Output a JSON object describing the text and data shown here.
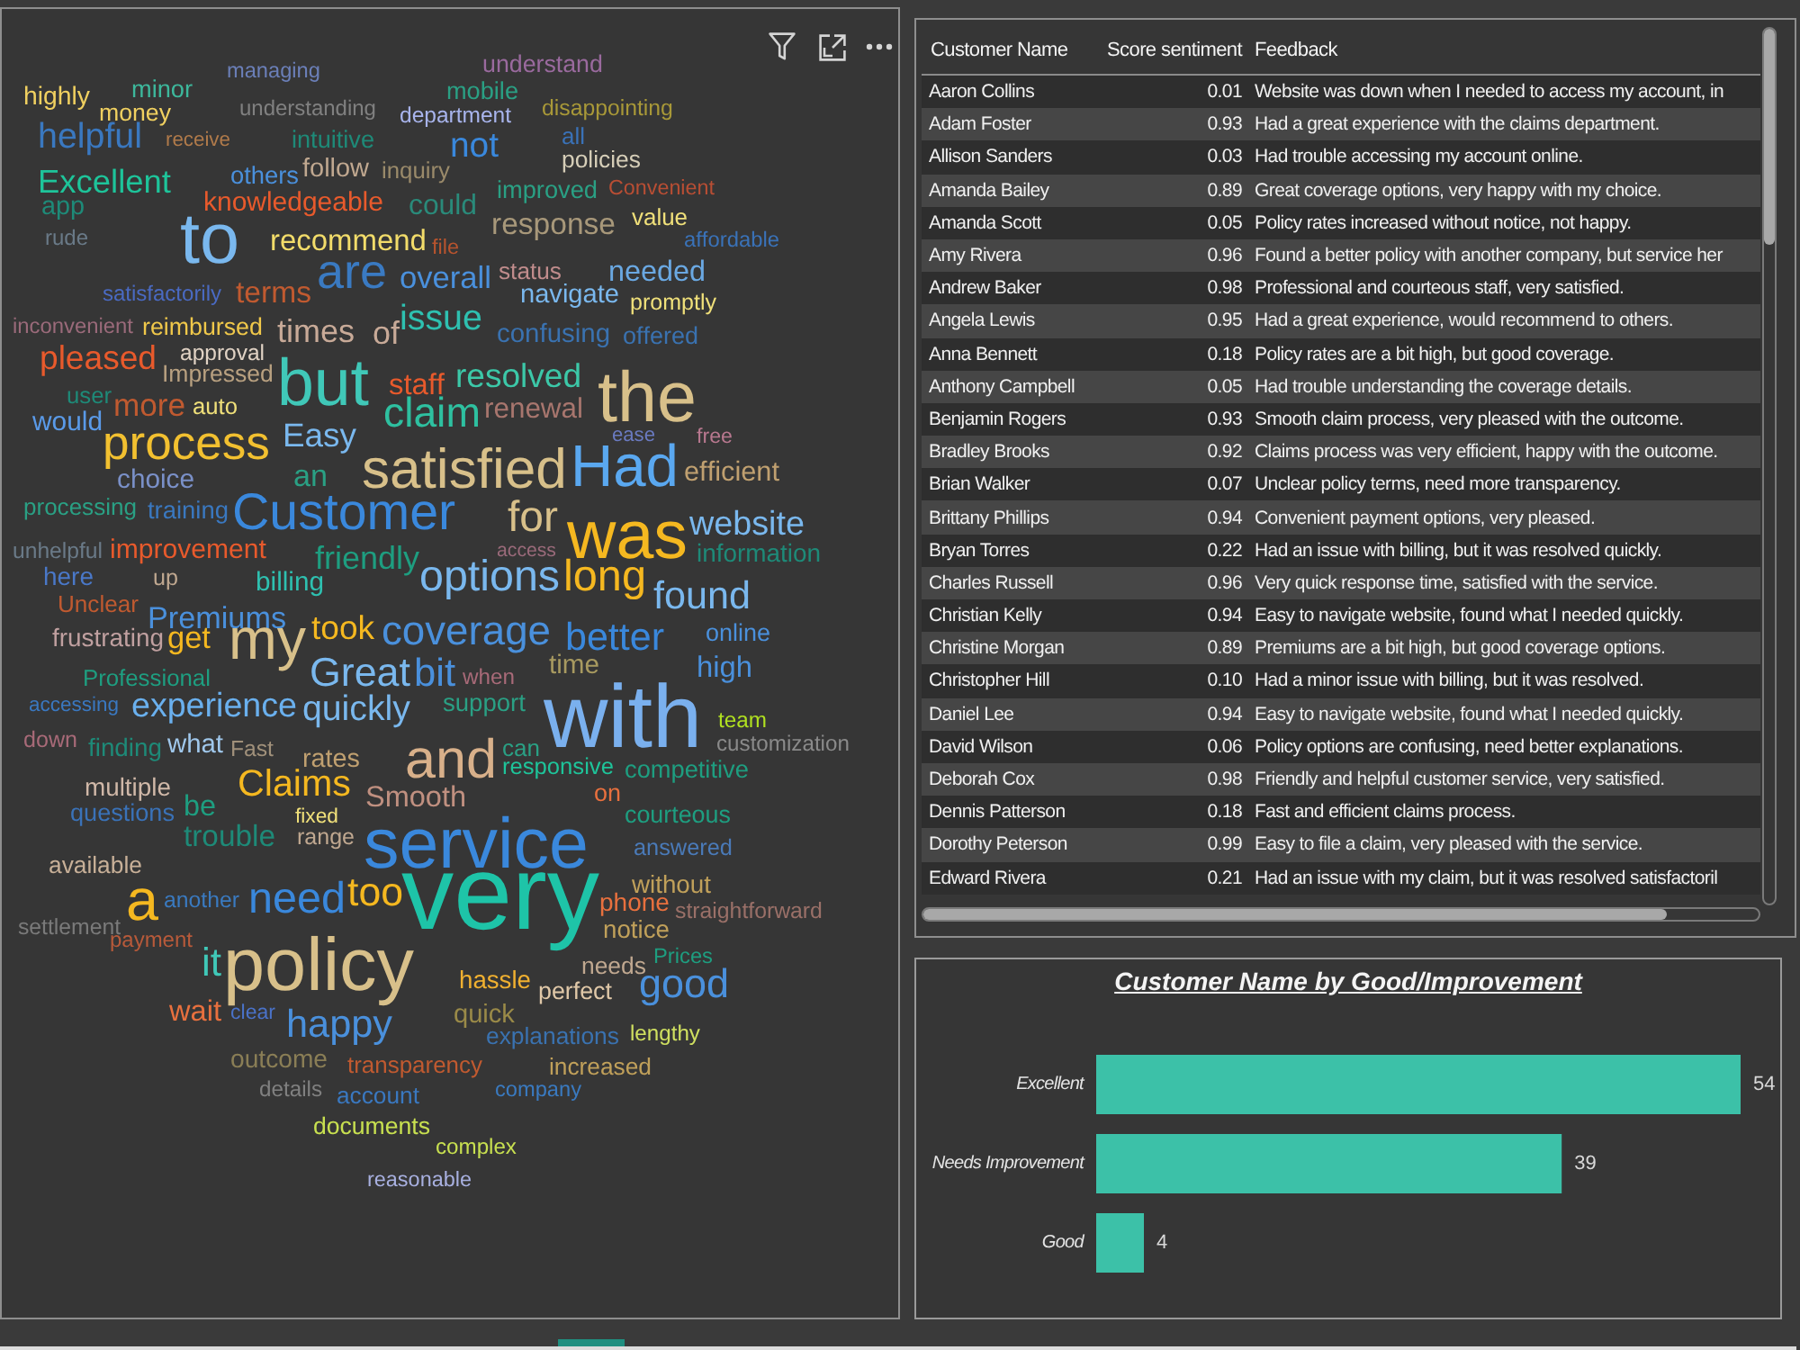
{
  "word_cloud": {
    "words": [
      {
        "text": "managing",
        "color": "#6b7fb8"
      },
      {
        "text": "understand",
        "color": "#9a6a9e"
      },
      {
        "text": "highly",
        "color": "#f0d060"
      },
      {
        "text": "minor",
        "color": "#3db89c"
      },
      {
        "text": "mobile",
        "color": "#2aa084"
      },
      {
        "text": "money",
        "color": "#f0d060"
      },
      {
        "text": "understanding",
        "color": "#808080"
      },
      {
        "text": "department",
        "color": "#a8b4ec"
      },
      {
        "text": "disappointing",
        "color": "#a89838"
      },
      {
        "text": "helpful",
        "color": "#3a78c0"
      },
      {
        "text": "receive",
        "color": "#b07a4a"
      },
      {
        "text": "intuitive",
        "color": "#1e8a78"
      },
      {
        "text": "not",
        "color": "#3a88dc"
      },
      {
        "text": "all",
        "color": "#3a72b8"
      },
      {
        "text": "follow",
        "color": "#c0a890"
      },
      {
        "text": "policies",
        "color": "#d6ceb8"
      },
      {
        "text": "Excellent",
        "color": "#1ec49a"
      },
      {
        "text": "others",
        "color": "#4a90dc"
      },
      {
        "text": "inquiry",
        "color": "#9a8a6a"
      },
      {
        "text": "improved",
        "color": "#2aa084"
      },
      {
        "text": "Convenient",
        "color": "#b84e34"
      },
      {
        "text": "app",
        "color": "#1e8a78"
      },
      {
        "text": "knowledgeable",
        "color": "#e85a2c"
      },
      {
        "text": "could",
        "color": "#2a8a7a"
      },
      {
        "text": "response",
        "color": "#a8987a"
      },
      {
        "text": "value",
        "color": "#f0e07a"
      },
      {
        "text": "rude",
        "color": "#6a7a88"
      },
      {
        "text": "to",
        "color": "#7ab8ee"
      },
      {
        "text": "recommend",
        "color": "#f2dc6a"
      },
      {
        "text": "file",
        "color": "#b8542e"
      },
      {
        "text": "affordable",
        "color": "#3a72b8"
      },
      {
        "text": "are",
        "color": "#3a7ac2"
      },
      {
        "text": "overall",
        "color": "#4a90dc"
      },
      {
        "text": "status",
        "color": "#c08c8c"
      },
      {
        "text": "needed",
        "color": "#6aa8e2"
      },
      {
        "text": "satisfactorily",
        "color": "#4a6ac2"
      },
      {
        "text": "terms",
        "color": "#c05a30"
      },
      {
        "text": "navigate",
        "color": "#7ab8ee"
      },
      {
        "text": "promptly",
        "color": "#f0e07a"
      },
      {
        "text": "inconvenient",
        "color": "#9a6a7a"
      },
      {
        "text": "reimbursed",
        "color": "#f0c84a"
      },
      {
        "text": "times",
        "color": "#c8aa98"
      },
      {
        "text": "of",
        "color": "#c8aa98"
      },
      {
        "text": "issue",
        "color": "#2ec0b0"
      },
      {
        "text": "confusing",
        "color": "#3a72b0"
      },
      {
        "text": "offered",
        "color": "#3a72b0"
      },
      {
        "text": "pleased",
        "color": "#e85a2c"
      },
      {
        "text": "approval",
        "color": "#e0d2c4"
      },
      {
        "text": "Impressed",
        "color": "#b8a080"
      },
      {
        "text": "but",
        "color": "#40c8b8"
      },
      {
        "text": "staff",
        "color": "#e85a2c"
      },
      {
        "text": "resolved",
        "color": "#3cc8a8"
      },
      {
        "text": "user",
        "color": "#1e8a78"
      },
      {
        "text": "more",
        "color": "#c05a30"
      },
      {
        "text": "auto",
        "color": "#f0e07a"
      },
      {
        "text": "would",
        "color": "#5a9ae8"
      },
      {
        "text": "claim",
        "color": "#2ec0a0"
      },
      {
        "text": "renewal",
        "color": "#a8766e"
      },
      {
        "text": "the",
        "color": "#d8c08a"
      },
      {
        "text": "process",
        "color": "#f2c030"
      },
      {
        "text": "Easy",
        "color": "#7ab8ee"
      },
      {
        "text": "ease",
        "color": "#6a7ac0"
      },
      {
        "text": "free",
        "color": "#b8788f"
      },
      {
        "text": "choice",
        "color": "#7a90c8"
      },
      {
        "text": "an",
        "color": "#2aa084"
      },
      {
        "text": "satisfied",
        "color": "#d8c08a"
      },
      {
        "text": "Had",
        "color": "#5aa8f0"
      },
      {
        "text": "efficient",
        "color": "#c0a070"
      },
      {
        "text": "processing",
        "color": "#2aa084"
      },
      {
        "text": "training",
        "color": "#3a78c0"
      },
      {
        "text": "Customer",
        "color": "#3a88dc"
      },
      {
        "text": "for",
        "color": "#d8c08a"
      },
      {
        "text": "was",
        "color": "#f5b820"
      },
      {
        "text": "website",
        "color": "#7ab8ee"
      },
      {
        "text": "unhelpful",
        "color": "#6a7a88"
      },
      {
        "text": "improvement",
        "color": "#e85a2c"
      },
      {
        "text": "friendly",
        "color": "#1e9e80"
      },
      {
        "text": "access",
        "color": "#9a6a7a"
      },
      {
        "text": "information",
        "color": "#1e8a78"
      },
      {
        "text": "here",
        "color": "#4a78c8"
      },
      {
        "text": "up",
        "color": "#c0a890"
      },
      {
        "text": "billing",
        "color": "#2ec0b0"
      },
      {
        "text": "options",
        "color": "#7ab8ee"
      },
      {
        "text": "long",
        "color": "#f5b820"
      },
      {
        "text": "Unclear",
        "color": "#c05a30"
      },
      {
        "text": "found",
        "color": "#7ab8ee"
      },
      {
        "text": "Premiums",
        "color": "#4a90dc"
      },
      {
        "text": "frustrating",
        "color": "#c0a0a0"
      },
      {
        "text": "get",
        "color": "#f5b820"
      },
      {
        "text": "my",
        "color": "#d8c08a"
      },
      {
        "text": "took",
        "color": "#f5b820"
      },
      {
        "text": "coverage",
        "color": "#4a90dc"
      },
      {
        "text": "better",
        "color": "#3a88dc"
      },
      {
        "text": "online",
        "color": "#4a90dc"
      },
      {
        "text": "Professional",
        "color": "#1e9e80"
      },
      {
        "text": "Great",
        "color": "#7ab8ee"
      },
      {
        "text": "bit",
        "color": "#4a90dc"
      },
      {
        "text": "when",
        "color": "#a86a78"
      },
      {
        "text": "time",
        "color": "#a89a60"
      },
      {
        "text": "high",
        "color": "#4a90dc"
      },
      {
        "text": "accessing",
        "color": "#3a78c0"
      },
      {
        "text": "experience",
        "color": "#6ab0ee"
      },
      {
        "text": "quickly",
        "color": "#7ab8ee"
      },
      {
        "text": "support",
        "color": "#2aa084"
      },
      {
        "text": "with",
        "color": "#7ab0ee"
      },
      {
        "text": "team",
        "color": "#b0e020"
      },
      {
        "text": "down",
        "color": "#a86a78"
      },
      {
        "text": "finding",
        "color": "#1e8a78"
      },
      {
        "text": "what",
        "color": "#a0c8ec"
      },
      {
        "text": "Fast",
        "color": "#a0907a"
      },
      {
        "text": "can",
        "color": "#2aa084"
      },
      {
        "text": "customization",
        "color": "#8a8a8a"
      },
      {
        "text": "rates",
        "color": "#c0a070"
      },
      {
        "text": "and",
        "color": "#d8b08a"
      },
      {
        "text": "responsive",
        "color": "#1ec49a"
      },
      {
        "text": "competitive",
        "color": "#1e9e80"
      },
      {
        "text": "multiple",
        "color": "#d0b8a8"
      },
      {
        "text": "Claims",
        "color": "#f5b820"
      },
      {
        "text": "Smooth",
        "color": "#c09080"
      },
      {
        "text": "on",
        "color": "#e8703e"
      },
      {
        "text": "questions",
        "color": "#3a72b8"
      },
      {
        "text": "be",
        "color": "#1e9e80"
      },
      {
        "text": "fixed",
        "color": "#f0e07a"
      },
      {
        "text": "courteous",
        "color": "#1e9e80"
      },
      {
        "text": "trouble",
        "color": "#1e8a78"
      },
      {
        "text": "range",
        "color": "#c0a890"
      },
      {
        "text": "service",
        "color": "#3a88dc"
      },
      {
        "text": "answered",
        "color": "#4a7ab8"
      },
      {
        "text": "available",
        "color": "#c8b098"
      },
      {
        "text": "a",
        "color": "#f5b820"
      },
      {
        "text": "another",
        "color": "#3a7ac0"
      },
      {
        "text": "need",
        "color": "#3a88dc"
      },
      {
        "text": "too",
        "color": "#f5b820"
      },
      {
        "text": "very",
        "color": "#1ec4a8"
      },
      {
        "text": "without",
        "color": "#c0a05a"
      },
      {
        "text": "phone",
        "color": "#e8703e"
      },
      {
        "text": "straightforward",
        "color": "#9a7068"
      },
      {
        "text": "settlement",
        "color": "#7a7a7a"
      },
      {
        "text": "payment",
        "color": "#b85a3a"
      },
      {
        "text": "notice",
        "color": "#c0a05a"
      },
      {
        "text": "it",
        "color": "#40c8b8"
      },
      {
        "text": "policy",
        "color": "#d8c08a"
      },
      {
        "text": "needs",
        "color": "#c0a890"
      },
      {
        "text": "Prices",
        "color": "#1e9e80"
      },
      {
        "text": "hassle",
        "color": "#f0b030"
      },
      {
        "text": "perfect",
        "color": "#e0c8a8"
      },
      {
        "text": "good",
        "color": "#4a90dc"
      },
      {
        "text": "wait",
        "color": "#e8703e"
      },
      {
        "text": "clear",
        "color": "#4a72c8"
      },
      {
        "text": "happy",
        "color": "#4a90dc"
      },
      {
        "text": "quick",
        "color": "#9a8a48"
      },
      {
        "text": "explanations",
        "color": "#3a72b0"
      },
      {
        "text": "lengthy",
        "color": "#d0e060"
      },
      {
        "text": "outcome",
        "color": "#8a7e56"
      },
      {
        "text": "transparency",
        "color": "#c05a30"
      },
      {
        "text": "increased",
        "color": "#c0a05a"
      },
      {
        "text": "details",
        "color": "#808080"
      },
      {
        "text": "account",
        "color": "#3a78c0"
      },
      {
        "text": "company",
        "color": "#3a7ac0"
      },
      {
        "text": "documents",
        "color": "#c8e050"
      },
      {
        "text": "complex",
        "color": "#c8e050"
      },
      {
        "text": "reasonable",
        "color": "#a8b0e0"
      }
    ]
  },
  "table": {
    "columns": [
      "Customer Name",
      "Score sentiment",
      "Feedback"
    ],
    "rows": [
      [
        "Aaron Collins",
        "0.01",
        "Website was down when I needed to access my account, in"
      ],
      [
        "Adam Foster",
        "0.93",
        "Had a great experience with the claims department."
      ],
      [
        "Allison Sanders",
        "0.03",
        "Had trouble accessing my account online."
      ],
      [
        "Amanda Bailey",
        "0.89",
        "Great coverage options, very happy with my choice."
      ],
      [
        "Amanda Scott",
        "0.05",
        "Policy rates increased without notice, not happy."
      ],
      [
        "Amy Rivera",
        "0.96",
        "Found a better policy with another company, but service her"
      ],
      [
        "Andrew Baker",
        "0.98",
        "Professional and courteous staff, very satisfied."
      ],
      [
        "Angela Lewis",
        "0.95",
        "Had a great experience, would recommend to others."
      ],
      [
        "Anna Bennett",
        "0.18",
        "Policy rates are a bit high, but good coverage."
      ],
      [
        "Anthony Campbell",
        "0.05",
        "Had trouble understanding the coverage details."
      ],
      [
        "Benjamin Rogers",
        "0.93",
        "Smooth claim process, very pleased with the outcome."
      ],
      [
        "Bradley Brooks",
        "0.92",
        "Claims process was very efficient, happy with the outcome."
      ],
      [
        "Brian Walker",
        "0.07",
        "Unclear policy terms, need more transparency."
      ],
      [
        "Brittany Phillips",
        "0.94",
        "Convenient payment options, very pleased."
      ],
      [
        "Bryan Torres",
        "0.22",
        "Had an issue with billing, but it was resolved quickly."
      ],
      [
        "Charles Russell",
        "0.96",
        "Very quick response time, satisfied with the service."
      ],
      [
        "Christian Kelly",
        "0.94",
        "Easy to navigate website, found what I needed quickly."
      ],
      [
        "Christine Morgan",
        "0.89",
        "Premiums are a bit high, but good coverage options."
      ],
      [
        "Christopher Hill",
        "0.10",
        "Had a minor issue with billing, but it was resolved."
      ],
      [
        "Daniel Lee",
        "0.94",
        "Easy to navigate website, found what I needed quickly."
      ],
      [
        "David Wilson",
        "0.06",
        "Policy options are confusing, need better explanations."
      ],
      [
        "Deborah Cox",
        "0.98",
        "Friendly and helpful customer service, very satisfied."
      ],
      [
        "Dennis Patterson",
        "0.18",
        "Fast and efficient claims process."
      ],
      [
        "Dorothy Peterson",
        "0.99",
        "Easy to file a claim, very pleased with the service."
      ],
      [
        "Edward Rivera",
        "0.21",
        "Had an issue with my claim, but it was resolved satisfactoril"
      ]
    ]
  },
  "chart": {
    "chart_data": {
      "type": "bar",
      "orientation": "horizontal",
      "title": "Customer Name by Good/Improvement",
      "categories": [
        "Excellent",
        "Needs Improvement",
        "Good"
      ],
      "values": [
        54,
        39,
        4
      ],
      "data_labels": true
    }
  }
}
